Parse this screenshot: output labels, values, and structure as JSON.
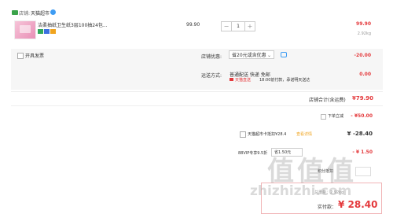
{
  "shop": {
    "label": "店铺:",
    "name": "天猫超市",
    "chat_icon": "wangwang-icon"
  },
  "item": {
    "title": "洁柔抽纸卫生纸3层100抽24包...",
    "unit_price": "99.90",
    "quantity": "1",
    "qty_minus": "−",
    "qty_plus": "+",
    "subtotal": "99.90",
    "weight": "2.92kg"
  },
  "invoice": {
    "label": "开具发票"
  },
  "discount": {
    "label": "店铺优惠:",
    "selected": "省20元或含优惠",
    "value": "-20.00"
  },
  "shipping": {
    "label": "运送方式:",
    "option": "普通配送 快递 免邮",
    "tag": "天猫直送",
    "note": "18:00前付款，承诺明天送达",
    "value": "0.00"
  },
  "shop_total": {
    "label": "店铺合计(含运费)",
    "value": "¥79.90"
  },
  "coupon": {
    "label": "下单立减",
    "value": "- ¥50.00"
  },
  "tmall_coupon": {
    "label": "天猫超市卡抵扣¥28.4",
    "link": "查看详情",
    "value": "¥ -28.40"
  },
  "vip": {
    "label": "88VIP专享9.5折",
    "selected": "省1.50元",
    "value": "- ¥ 1.50"
  },
  "deduct": {
    "label": "积分抵扣"
  },
  "final": {
    "weight": "总重量：2.92kg",
    "label": "实付款：",
    "value": "¥ 28.40"
  },
  "watermark": {
    "text": "值值值",
    "site": "zhizhizhi.com"
  },
  "colors": {
    "accent": "#e4393c",
    "shop_icon": "#3aa34a",
    "chat": "#3e9cf3"
  }
}
